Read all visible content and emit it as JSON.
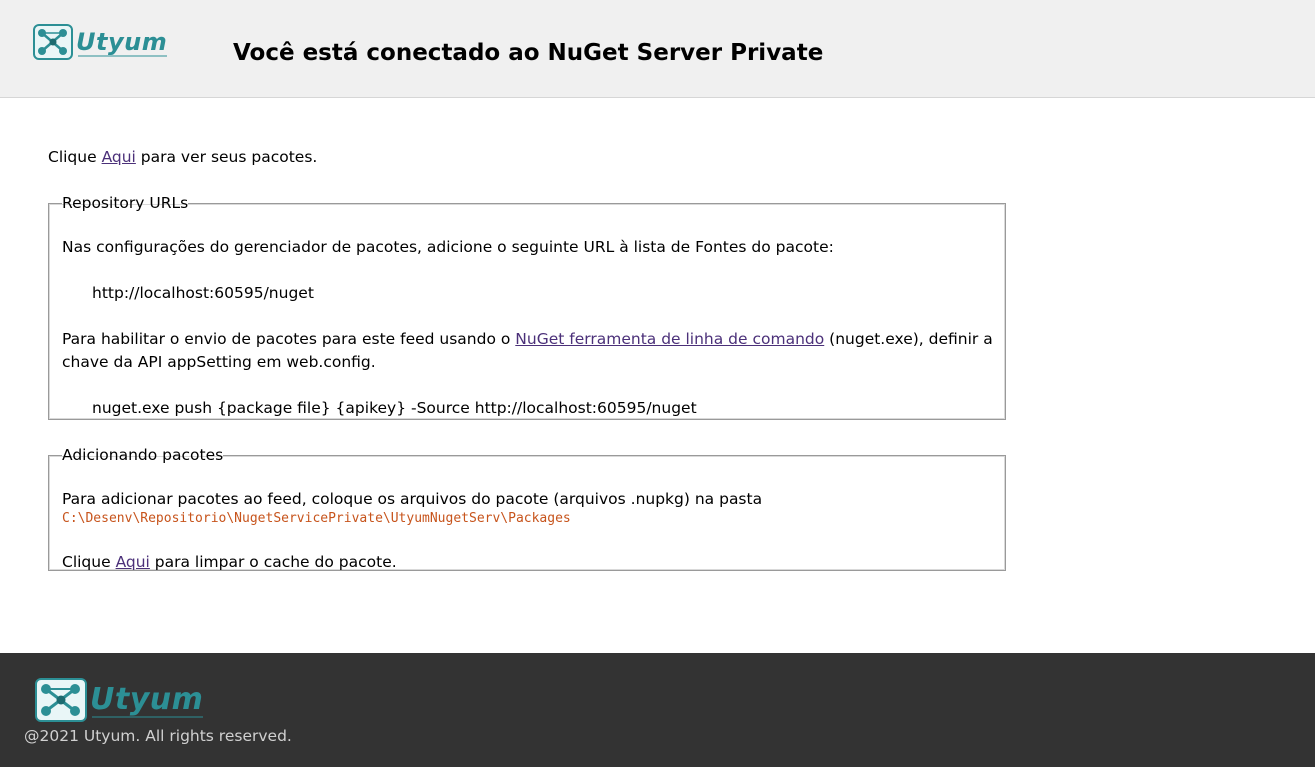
{
  "brand": {
    "name": "Utyum",
    "color": "#2c8f95"
  },
  "header": {
    "title": "Você está conectado ao NuGet Server Private"
  },
  "intro": {
    "before": "Clique ",
    "link": "Aqui",
    "after": " para ver seus pacotes."
  },
  "repository": {
    "legend": "Repository URLs",
    "instructions": "Nas configurações do gerenciador de pacotes, adicione o seguinte URL à lista de Fontes do pacote:",
    "source_url": "http://localhost:60595/nuget",
    "push_before": "Para habilitar o envio de pacotes para este feed usando o ",
    "push_link": "NuGet ferramenta de linha de comando",
    "push_after": " (nuget.exe), definir a",
    "push_line2": "chave da API appSetting em web.config.",
    "push_command": "nuget.exe push {package file} {apikey} -Source http://localhost:60595/nuget"
  },
  "adding": {
    "legend": "Adicionando pacotes",
    "instructions": "Para adicionar pacotes ao feed, coloque os arquivos do pacote (arquivos .nupkg) na pasta",
    "folder_path": "C:\\Desenv\\Repositorio\\NugetServicePrivate\\UtyumNugetServ\\Packages",
    "clear_before": "Clique ",
    "clear_link": "Aqui",
    "clear_after": " para limpar o cache do pacote."
  },
  "footer": {
    "copyright": "@2021 Utyum. All rights reserved."
  },
  "colors": {
    "link": "#4b3079",
    "path": "#c7541c",
    "footer_bg": "#333333",
    "header_bg": "#f0f0f0"
  },
  "icons": {
    "logo": "utyum-logo-icon"
  }
}
